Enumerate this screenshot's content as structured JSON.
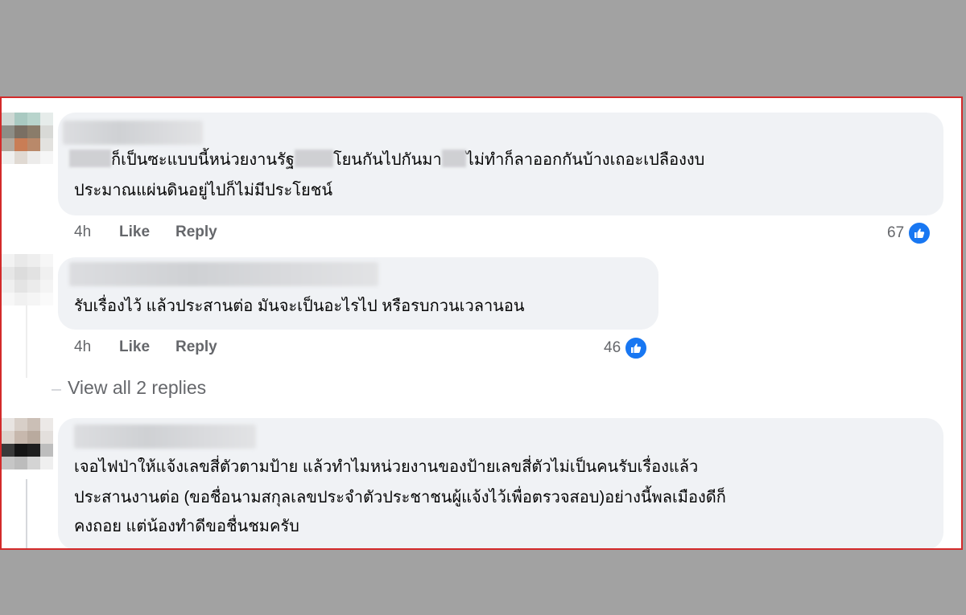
{
  "colors": {
    "background": "#a2a2a2",
    "border": "#d32a2a",
    "bubble": "#f0f2f5",
    "text": "#050505",
    "meta": "#65676b",
    "like_blue": "#1877f2"
  },
  "comments": [
    {
      "text_lines": [
        "ก็เป็นซะแบบนี้หน่วยงานรัฐ",
        "โยนกันไปกันมา",
        "ไม่ทำก็ลาออกกันบ้างเถอะเปลืองงบ",
        "ประมาณแผ่นดินอยู่ไปก็ไม่มีประโยชน์"
      ],
      "time": "4h",
      "like_label": "Like",
      "reply_label": "Reply",
      "reaction_count": "67",
      "reaction_icon": "thumbs-up-icon"
    },
    {
      "text_lines": [
        "รับเรื่องไว้ แล้วประสานต่อ มันจะเป็นอะไรไป หรือรบกวนเวลานอน"
      ],
      "time": "4h",
      "like_label": "Like",
      "reply_label": "Reply",
      "reaction_count": "46",
      "reaction_icon": "thumbs-up-icon"
    },
    {
      "text_lines": [
        "เจอไฟป่าให้แจ้งเลขสี่ตัวตามป้าย แล้วทำไมหน่วยงานของป้ายเลขสี่ตัวไม่เป็นคนรับเรื่องแล้ว",
        "ประสานงานต่อ (ขอชื่อนามสกุลเลขประจำตัวประชาชนผู้แจ้งไว้เพื่อตรวจสอบ)อย่างนี้พลเมืองดีก็",
        "คงถอย แต่น้องทำดีขอชื่นชมครับ"
      ]
    }
  ],
  "view_replies_label": "View all 2 replies"
}
